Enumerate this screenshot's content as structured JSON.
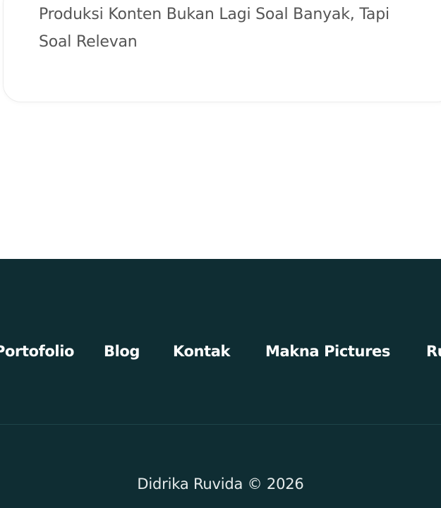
{
  "article_card": {
    "title": "Produksi Konten Bukan Lagi Soal Banyak, Tapi Soal Relevan"
  },
  "footer": {
    "nav_links": [
      {
        "label": "Portofolio"
      },
      {
        "label": "Blog"
      },
      {
        "label": "Kontak"
      },
      {
        "label": "Makna Pictures"
      },
      {
        "label": "Ru"
      }
    ],
    "copyright": "Didrika Ruvida © 2026"
  },
  "colors": {
    "footer_background": "#0f2d33",
    "footer_text": "#ffffff",
    "card_text": "#555555"
  }
}
